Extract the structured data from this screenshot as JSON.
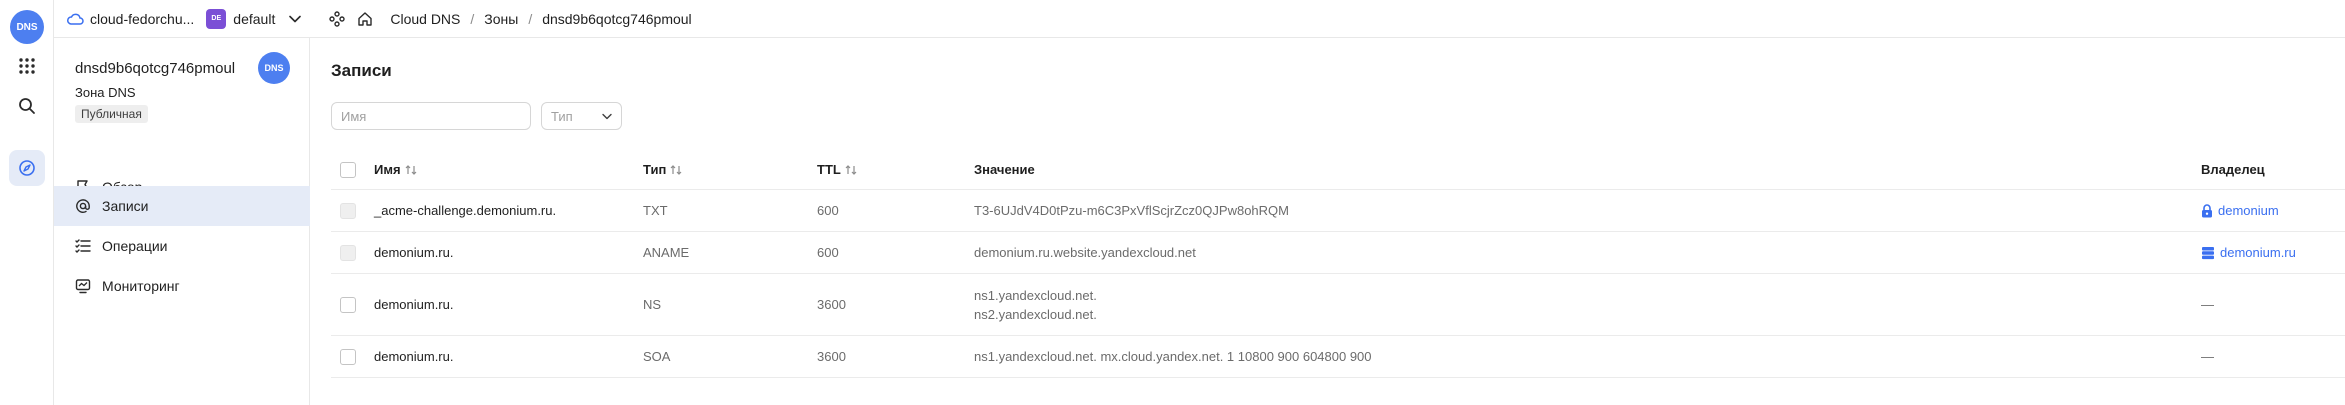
{
  "rail": {
    "logo_text": "DNS"
  },
  "header": {
    "cloud": "cloud-fedorchu...",
    "folder_badge": "DE",
    "folder": "default",
    "breadcrumbs": [
      "Cloud DNS",
      "Зоны",
      "dnsd9b6qotcg746pmoul"
    ]
  },
  "sidebar": {
    "title": "dnsd9b6qotcg746pmoul",
    "subtitle": "Зона DNS",
    "badge": "Публичная",
    "avatar_text": "DNS",
    "items": [
      {
        "label": "Обзор",
        "icon": "flag-icon"
      },
      {
        "label": "Записи",
        "icon": "at-icon"
      },
      {
        "label": "Операции",
        "icon": "list-icon"
      },
      {
        "label": "Мониторинг",
        "icon": "monitor-icon"
      }
    ]
  },
  "main": {
    "title": "Записи",
    "search_placeholder": "Имя",
    "type_placeholder": "Тип",
    "columns": {
      "name": "Имя",
      "type": "Тип",
      "ttl": "TTL",
      "value": "Значение",
      "owner": "Владелец"
    },
    "rows": [
      {
        "name": "_acme-challenge.demonium.ru.",
        "type": "TXT",
        "ttl": "600",
        "values": [
          "T3-6UJdV4D0tPzu-m6C3PxVflScjrZcz0QJPw8ohRQM"
        ],
        "owner": "demonium"
      },
      {
        "name": "demonium.ru.",
        "type": "ANAME",
        "ttl": "600",
        "values": [
          "demonium.ru.website.yandexcloud.net"
        ],
        "owner": "demonium.ru"
      },
      {
        "name": "demonium.ru.",
        "type": "NS",
        "ttl": "3600",
        "values": [
          "ns1.yandexcloud.net.",
          "ns2.yandexcloud.net."
        ],
        "owner": "—"
      },
      {
        "name": "demonium.ru.",
        "type": "SOA",
        "ttl": "3600",
        "values": [
          "ns1.yandexcloud.net. mx.cloud.yandex.net. 1 10800 900 604800 900"
        ],
        "owner": "—"
      }
    ]
  },
  "colors": {
    "accent": "#4d7ff0",
    "link": "#3a6ff0",
    "active_bg": "#e5ebf7"
  }
}
